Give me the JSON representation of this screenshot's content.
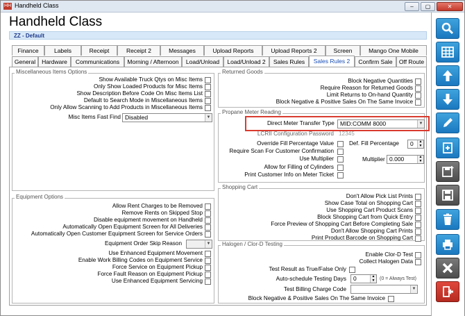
{
  "window": {
    "title": "Handheld Class",
    "app_icon": "HH",
    "controls": [
      "–",
      "▢",
      "✕"
    ]
  },
  "header": {
    "title": "Handheld Class",
    "record": "ZZ - Default"
  },
  "tabs_row1": [
    "Finance",
    "Labels",
    "Receipt",
    "Receipt 2",
    "Messages",
    "Upload Reports",
    "Upload Reports 2",
    "Screen",
    "Mango One Mobile"
  ],
  "tabs_row2": [
    "General",
    "Hardware",
    "Communications",
    "Morning / Afternoon",
    "Load/Unload",
    "Load/Unload 2",
    "Sales Rules",
    "Sales Rules 2",
    "Confirm Sale",
    "Off Route"
  ],
  "active_tab": "Sales Rules 2",
  "misc": {
    "title": "Miscellaneous Items Options",
    "items": [
      "Show Available Truck Qtys on Misc Items",
      "Only Show Loaded Products for Misc Items",
      "Show Description Before Code On Misc Items List",
      "Default to Search Mode in Miscellaneous Items",
      "Only Allow Scanning to Add Products in Miscellaneous Items"
    ],
    "fast_find_label": "Misc Items Fast Find",
    "fast_find_value": "Disabled"
  },
  "equipment": {
    "title": "Equipment Options",
    "items_a": [
      "Allow Rent Charges to be Removed",
      "Remove Rents on Skipped Stop",
      "Disable equipment movement on Handheld",
      "Automatically Open Equipment Screen for All Deliveries",
      "Automatically Open Customer Equipment Screen for Service Orders"
    ],
    "skip_reason_label": "Equipment Order Skip Reason",
    "items_b": [
      "Use Enhanced Equipment Movement",
      "Enable Work Billing Codes on Equipment Service",
      "Force Service on Equipment Pickup",
      "Force Fault Reason on Equipment Pickup",
      "Use Enhanced Equipment Servicing"
    ]
  },
  "returned": {
    "title": "Returned Goods",
    "items": [
      "Block Negative Quantities",
      "Require Reason for Returned Goods",
      "Limit Returns to On-hand Quantity",
      "Block Negative & Positive Sales On The Same Invoice"
    ]
  },
  "propane": {
    "title": "Propane Meter Reading",
    "transfer_label": "Direct Meter Transfer Type",
    "transfer_value": "MID:COMM 8000",
    "lcrii_label": "LCRII Configuration Password",
    "lcrii_value": "12345",
    "override_label": "Override Fill Percentage Value",
    "def_fill_label": "Def. Fill Percentage",
    "def_fill_value": "0",
    "require_scan_label": "Require Scan For Customer Confirmation",
    "use_multiplier_label": "Use Multiplier",
    "multiplier_label": "Multiplier",
    "multiplier_value": "0.000",
    "allow_fill_label": "Allow for Filling of Cylinders",
    "print_customer_label": "Print Customer Info on Meter Ticket"
  },
  "cart": {
    "title": "Shopping Cart",
    "items": [
      "Don't Allow Pick List Prints",
      "Show Case Total on Shopping Cart",
      "Use Shopping Cart Product Scans",
      "Block Shopping Cart from Quick Entry",
      "Force Preview of Shopping Cart Before Completing Sale",
      "Don't Allow Shopping Cart Prints",
      "Print Product Barcode on Shopping Cart"
    ]
  },
  "halogen": {
    "title": "Halogen / Clor-D Testing",
    "enable_label": "Enable Clor-D Test",
    "collect_label": "Collect Halogen Data",
    "true_false_label": "Test Result as True/False Only",
    "auto_label": "Auto-schedule Testing Days",
    "auto_value": "0",
    "auto_note": "(0 = Always Test)",
    "billing_label": "Test Billing Charge Code",
    "block_label": "Block Negative & Positive Sales On The Same Invoice"
  },
  "highlight_color": "#d93a2e",
  "sidebar": [
    "search-icon",
    "grid-icon",
    "arrow-up-icon",
    "arrow-down-icon",
    "pencil-icon",
    "add-document-icon",
    "add-disk-icon",
    "save-icon",
    "trash-icon",
    "print-icon",
    "cancel-icon",
    "exit-icon"
  ]
}
